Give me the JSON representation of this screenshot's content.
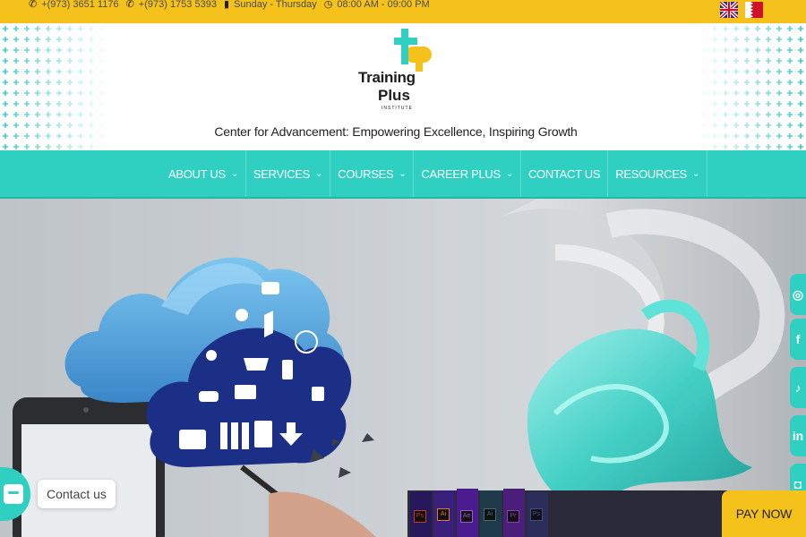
{
  "topbar": {
    "phone1": "+(973) 3651 1176",
    "phone2": "+(973) 1753 5393",
    "days": "Sunday - Thursday",
    "hours": "08:00 AM - 09:00 PM"
  },
  "header": {
    "logo_line1": "Training",
    "logo_line2": "Plus",
    "logo_line3": "INSTITUTE",
    "tagline": "Center for Advancement: Empowering Excellence, Inspiring Growth"
  },
  "nav": {
    "items": [
      {
        "label": "ABOUT US",
        "dropdown": true
      },
      {
        "label": "SERVICES",
        "dropdown": true
      },
      {
        "label": "COURSES",
        "dropdown": true
      },
      {
        "label": "CAREER PLUS",
        "dropdown": true
      },
      {
        "label": "CONTACT US",
        "dropdown": false
      },
      {
        "label": "RESOURCES",
        "dropdown": true
      }
    ]
  },
  "widgets": {
    "contact_label": "Contact us",
    "paynow_label": "PAY NOW"
  },
  "socials": [
    "whatsapp-icon",
    "facebook-icon",
    "tiktok-icon",
    "linkedin-icon",
    "instagram-icon"
  ],
  "app_icons": [
    "Ps",
    "Ai",
    "Ae",
    "Ai",
    "Pr",
    "Ps"
  ],
  "colors": {
    "yellow": "#f5c21b",
    "teal": "#2fd0c2",
    "dark": "#222222"
  }
}
